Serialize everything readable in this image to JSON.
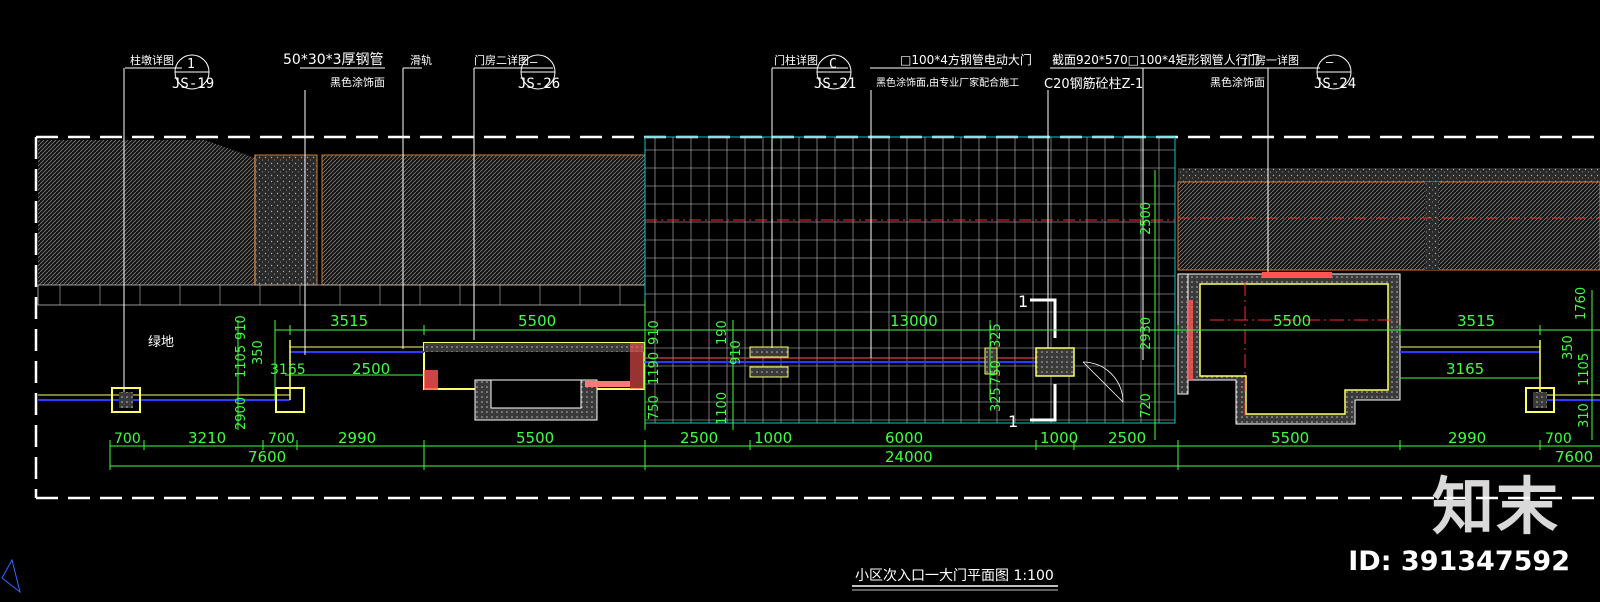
{
  "colors": {
    "background": "#000000",
    "dimension": "#3fff3f",
    "label": "#ffffff",
    "wall": "#ffff66",
    "rail": "#2a3cff",
    "hatch": "#cc7a33",
    "grid": "#00c8c8",
    "axis": "#ff2a2a"
  },
  "callouts": [
    {
      "text": "柱墩详图",
      "ref_top": "1",
      "ref_bottom": "JS-19"
    },
    {
      "text": "50*30*3厚钢管",
      "sub": "黑色涂饰面"
    },
    {
      "text": "滑轨"
    },
    {
      "text": "门房二详图",
      "ref_top": "—",
      "ref_bottom": "JS-26"
    },
    {
      "text": "门柱详图",
      "ref_top": "C",
      "ref_bottom": "JS-21"
    },
    {
      "text": "□100*4方钢管电动大门",
      "sub": "黑色涂饰面,由专业厂家配合施工"
    },
    {
      "text": "截面920*570□100*4矩形钢管人行门",
      "sub": "C20钢筋砼柱Z-1"
    },
    {
      "text": "黑色涂饰面"
    },
    {
      "text": "门房一详图",
      "ref_top": "—",
      "ref_bottom": "JS-24"
    }
  ],
  "labels": {
    "green_area": "绿地",
    "section_mark": "1"
  },
  "dimensions": {
    "upper": [
      "3515",
      "5500",
      "13000",
      "5500",
      "3515"
    ],
    "inner": [
      "2500",
      "3165",
      "3165"
    ],
    "lower": [
      "700",
      "3210",
      "700",
      "2990",
      "5500",
      "2500",
      "1000",
      "6000",
      "1000",
      "2500",
      "5500",
      "2990",
      "700"
    ],
    "totals": [
      "7600",
      "24000",
      "7600"
    ],
    "vertical": [
      "910",
      "1105",
      "350",
      "2900",
      "910",
      "1190",
      "750",
      "910",
      "190",
      "1100",
      "750",
      "325",
      "325",
      "2500",
      "2930",
      "720",
      "1760",
      "350",
      "1105",
      "310"
    ]
  },
  "title": "小区次入口一大门平面图 1:100",
  "brand": "知末",
  "drawing_id": "ID: 391347592"
}
